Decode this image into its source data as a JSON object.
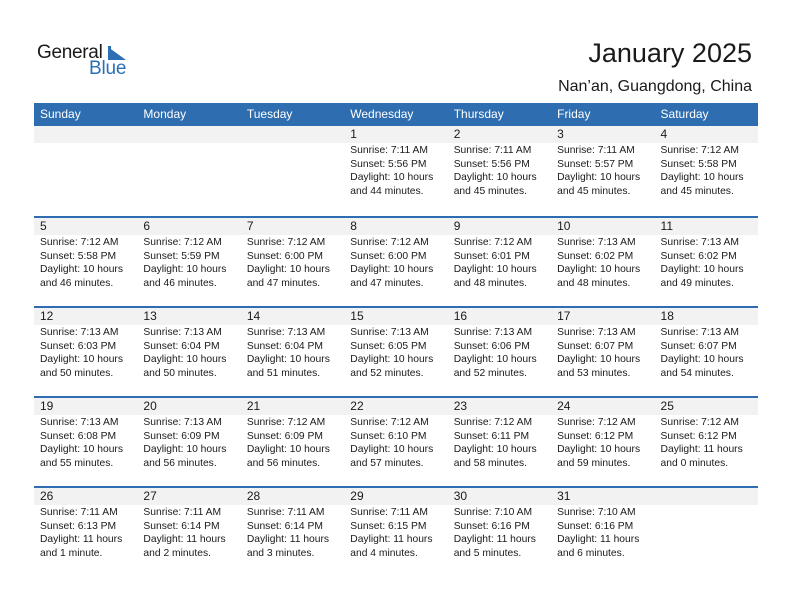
{
  "logo": {
    "text_general": "General",
    "text_blue": "Blue",
    "brand_color": "#2d6fb5"
  },
  "header": {
    "title": "January 2025",
    "location": "Nan’an, Guangdong, China"
  },
  "colors": {
    "header_bg": "#2e6db0",
    "day_bar_bg": "#f2f2f2"
  },
  "weekdays": [
    "Sunday",
    "Monday",
    "Tuesday",
    "Wednesday",
    "Thursday",
    "Friday",
    "Saturday"
  ],
  "weeks": [
    [
      null,
      null,
      null,
      {
        "day": "1",
        "sunrise": "Sunrise: 7:11 AM",
        "sunset": "Sunset: 5:56 PM",
        "daylight1": "Daylight: 10 hours",
        "daylight2": "and 44 minutes."
      },
      {
        "day": "2",
        "sunrise": "Sunrise: 7:11 AM",
        "sunset": "Sunset: 5:56 PM",
        "daylight1": "Daylight: 10 hours",
        "daylight2": "and 45 minutes."
      },
      {
        "day": "3",
        "sunrise": "Sunrise: 7:11 AM",
        "sunset": "Sunset: 5:57 PM",
        "daylight1": "Daylight: 10 hours",
        "daylight2": "and 45 minutes."
      },
      {
        "day": "4",
        "sunrise": "Sunrise: 7:12 AM",
        "sunset": "Sunset: 5:58 PM",
        "daylight1": "Daylight: 10 hours",
        "daylight2": "and 45 minutes."
      }
    ],
    [
      {
        "day": "5",
        "sunrise": "Sunrise: 7:12 AM",
        "sunset": "Sunset: 5:58 PM",
        "daylight1": "Daylight: 10 hours",
        "daylight2": "and 46 minutes."
      },
      {
        "day": "6",
        "sunrise": "Sunrise: 7:12 AM",
        "sunset": "Sunset: 5:59 PM",
        "daylight1": "Daylight: 10 hours",
        "daylight2": "and 46 minutes."
      },
      {
        "day": "7",
        "sunrise": "Sunrise: 7:12 AM",
        "sunset": "Sunset: 6:00 PM",
        "daylight1": "Daylight: 10 hours",
        "daylight2": "and 47 minutes."
      },
      {
        "day": "8",
        "sunrise": "Sunrise: 7:12 AM",
        "sunset": "Sunset: 6:00 PM",
        "daylight1": "Daylight: 10 hours",
        "daylight2": "and 47 minutes."
      },
      {
        "day": "9",
        "sunrise": "Sunrise: 7:12 AM",
        "sunset": "Sunset: 6:01 PM",
        "daylight1": "Daylight: 10 hours",
        "daylight2": "and 48 minutes."
      },
      {
        "day": "10",
        "sunrise": "Sunrise: 7:13 AM",
        "sunset": "Sunset: 6:02 PM",
        "daylight1": "Daylight: 10 hours",
        "daylight2": "and 48 minutes."
      },
      {
        "day": "11",
        "sunrise": "Sunrise: 7:13 AM",
        "sunset": "Sunset: 6:02 PM",
        "daylight1": "Daylight: 10 hours",
        "daylight2": "and 49 minutes."
      }
    ],
    [
      {
        "day": "12",
        "sunrise": "Sunrise: 7:13 AM",
        "sunset": "Sunset: 6:03 PM",
        "daylight1": "Daylight: 10 hours",
        "daylight2": "and 50 minutes."
      },
      {
        "day": "13",
        "sunrise": "Sunrise: 7:13 AM",
        "sunset": "Sunset: 6:04 PM",
        "daylight1": "Daylight: 10 hours",
        "daylight2": "and 50 minutes."
      },
      {
        "day": "14",
        "sunrise": "Sunrise: 7:13 AM",
        "sunset": "Sunset: 6:04 PM",
        "daylight1": "Daylight: 10 hours",
        "daylight2": "and 51 minutes."
      },
      {
        "day": "15",
        "sunrise": "Sunrise: 7:13 AM",
        "sunset": "Sunset: 6:05 PM",
        "daylight1": "Daylight: 10 hours",
        "daylight2": "and 52 minutes."
      },
      {
        "day": "16",
        "sunrise": "Sunrise: 7:13 AM",
        "sunset": "Sunset: 6:06 PM",
        "daylight1": "Daylight: 10 hours",
        "daylight2": "and 52 minutes."
      },
      {
        "day": "17",
        "sunrise": "Sunrise: 7:13 AM",
        "sunset": "Sunset: 6:07 PM",
        "daylight1": "Daylight: 10 hours",
        "daylight2": "and 53 minutes."
      },
      {
        "day": "18",
        "sunrise": "Sunrise: 7:13 AM",
        "sunset": "Sunset: 6:07 PM",
        "daylight1": "Daylight: 10 hours",
        "daylight2": "and 54 minutes."
      }
    ],
    [
      {
        "day": "19",
        "sunrise": "Sunrise: 7:13 AM",
        "sunset": "Sunset: 6:08 PM",
        "daylight1": "Daylight: 10 hours",
        "daylight2": "and 55 minutes."
      },
      {
        "day": "20",
        "sunrise": "Sunrise: 7:13 AM",
        "sunset": "Sunset: 6:09 PM",
        "daylight1": "Daylight: 10 hours",
        "daylight2": "and 56 minutes."
      },
      {
        "day": "21",
        "sunrise": "Sunrise: 7:12 AM",
        "sunset": "Sunset: 6:09 PM",
        "daylight1": "Daylight: 10 hours",
        "daylight2": "and 56 minutes."
      },
      {
        "day": "22",
        "sunrise": "Sunrise: 7:12 AM",
        "sunset": "Sunset: 6:10 PM",
        "daylight1": "Daylight: 10 hours",
        "daylight2": "and 57 minutes."
      },
      {
        "day": "23",
        "sunrise": "Sunrise: 7:12 AM",
        "sunset": "Sunset: 6:11 PM",
        "daylight1": "Daylight: 10 hours",
        "daylight2": "and 58 minutes."
      },
      {
        "day": "24",
        "sunrise": "Sunrise: 7:12 AM",
        "sunset": "Sunset: 6:12 PM",
        "daylight1": "Daylight: 10 hours",
        "daylight2": "and 59 minutes."
      },
      {
        "day": "25",
        "sunrise": "Sunrise: 7:12 AM",
        "sunset": "Sunset: 6:12 PM",
        "daylight1": "Daylight: 11 hours",
        "daylight2": "and 0 minutes."
      }
    ],
    [
      {
        "day": "26",
        "sunrise": "Sunrise: 7:11 AM",
        "sunset": "Sunset: 6:13 PM",
        "daylight1": "Daylight: 11 hours",
        "daylight2": "and 1 minute."
      },
      {
        "day": "27",
        "sunrise": "Sunrise: 7:11 AM",
        "sunset": "Sunset: 6:14 PM",
        "daylight1": "Daylight: 11 hours",
        "daylight2": "and 2 minutes."
      },
      {
        "day": "28",
        "sunrise": "Sunrise: 7:11 AM",
        "sunset": "Sunset: 6:14 PM",
        "daylight1": "Daylight: 11 hours",
        "daylight2": "and 3 minutes."
      },
      {
        "day": "29",
        "sunrise": "Sunrise: 7:11 AM",
        "sunset": "Sunset: 6:15 PM",
        "daylight1": "Daylight: 11 hours",
        "daylight2": "and 4 minutes."
      },
      {
        "day": "30",
        "sunrise": "Sunrise: 7:10 AM",
        "sunset": "Sunset: 6:16 PM",
        "daylight1": "Daylight: 11 hours",
        "daylight2": "and 5 minutes."
      },
      {
        "day": "31",
        "sunrise": "Sunrise: 7:10 AM",
        "sunset": "Sunset: 6:16 PM",
        "daylight1": "Daylight: 11 hours",
        "daylight2": "and 6 minutes."
      },
      null
    ]
  ]
}
